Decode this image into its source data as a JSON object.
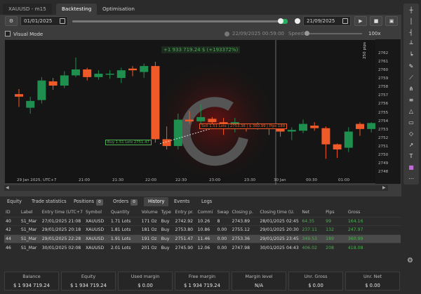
{
  "header": {
    "symbol_tab": "XAUUSD - m15",
    "tabs": [
      "Backtesting",
      "Optimisation"
    ]
  },
  "toolbar": {
    "start_date": "01/01/2025",
    "end_date": "21/09/2025",
    "play": "▶",
    "stop": "■",
    "save": "▣"
  },
  "chart_header": {
    "visual_mode": "Visual Mode",
    "datetime": "22/09/2025 00:59:00",
    "speed_label": "Speed:",
    "zoom": "100x"
  },
  "colors": {
    "bull": "#1e8f4e",
    "bear": "#f05a28",
    "positive": "#4caf50"
  },
  "chart_data": {
    "type": "candlestick",
    "x_labels": [
      "29 Jan 2025, UTC+7",
      "21:00",
      "21:30",
      "22:00",
      "22:30",
      "23:00",
      "23:30",
      "30 Jan",
      "00:30",
      "01:00"
    ],
    "y_ticks": [
      2762,
      2761,
      2760,
      2759,
      2758,
      2757,
      2756,
      2755,
      2754,
      2753,
      2752,
      2751,
      2750,
      2749,
      2748
    ],
    "ylim": [
      2747.5,
      2763
    ],
    "candles": [
      [
        2757.3,
        2757.0,
        2755.8,
        2757.9
      ],
      [
        2755.7,
        2756.5,
        2755.0,
        2757.0
      ],
      [
        2756.6,
        2758.9,
        2756.2,
        2759.3
      ],
      [
        2758.8,
        2758.3,
        2757.8,
        2759.2
      ],
      [
        2758.3,
        2759.5,
        2758.0,
        2760.0
      ],
      [
        2759.5,
        2760.2,
        2759.3,
        2761.6
      ],
      [
        2760.2,
        2759.3,
        2758.9,
        2760.4
      ],
      [
        2759.3,
        2759.7,
        2759.0,
        2760.1
      ],
      [
        2759.7,
        2759.7,
        2759.1,
        2760.1
      ],
      [
        2759.2,
        2760.1,
        2758.6,
        2760.4
      ],
      [
        2760.3,
        2760.1,
        2759.4,
        2760.6
      ],
      [
        2759.9,
        2760.6,
        2759.2,
        2760.9
      ],
      [
        2760.6,
        2752.0,
        2751.6,
        2761.1
      ],
      [
        2752.0,
        2751.2,
        2750.8,
        2753.5
      ],
      [
        2751.2,
        2754.3,
        2750.8,
        2755.0
      ],
      [
        2754.3,
        2754.1,
        2753.8,
        2755.3
      ],
      [
        2754.1,
        2754.6,
        2753.6,
        2756.1
      ],
      [
        2754.4,
        2754.0,
        2753.8,
        2754.6
      ],
      [
        2754.0,
        2753.2,
        2752.5,
        2754.5
      ],
      [
        2753.5,
        2754.0,
        2752.8,
        2754.5
      ],
      [
        2753.8,
        2753.4,
        2752.9,
        2753.8
      ],
      [
        2753.4,
        2753.6,
        2753.1,
        2754.0
      ],
      [
        2753.5,
        2753.2,
        2752.5,
        2753.7
      ],
      [
        2753.2,
        2752.9,
        2752.3,
        2753.7
      ],
      [
        2752.9,
        2753.1,
        2751.9,
        2753.4
      ],
      [
        2753.0,
        2753.8,
        2752.7,
        2754.3
      ],
      [
        2753.6,
        2753.3,
        2753.0,
        2754.0
      ],
      [
        2753.3,
        2751.4,
        2749.7,
        2753.5
      ],
      [
        2751.4,
        2750.8,
        2749.8,
        2751.5
      ],
      [
        2751.0,
        2752.9,
        2750.5,
        2753.4
      ],
      [
        2753.8,
        2753.2,
        2752.4,
        2754.0
      ],
      [
        2753.2,
        2753.9,
        2752.8,
        2754.0
      ]
    ]
  },
  "annotations": {
    "pnl": "+1 933 719.24 $ (+193372%)",
    "pips_label": "250 pips",
    "buy": "Buy 1.51 Lots 2751.47",
    "sell": "Sell 1.51 Lots",
    "sell_price": "2753.36",
    "sell_pnl": "$ 360.99",
    "sell_pips": "Pips 189"
  },
  "bottom_tabs": [
    {
      "label": "Equity"
    },
    {
      "label": "Trade statistics"
    },
    {
      "label": "Positions",
      "badge": "0"
    },
    {
      "label": "Orders",
      "badge": "0"
    },
    {
      "label": "History"
    },
    {
      "label": "Events"
    },
    {
      "label": "Logs"
    }
  ],
  "table": {
    "headers": [
      "ID",
      "Label",
      "Entry time (UTC+7",
      "Symbol",
      "Quantity",
      "Volume",
      "Type",
      "Entry pr.",
      "Commi",
      "Swap",
      "Closing p.",
      "Closing time (U.",
      "Net",
      "Pips",
      "Gross"
    ],
    "rows": [
      [
        "40",
        "S1_Mar",
        "27/01/2025 21:08",
        "XAUUSD",
        "1.71 Lots",
        "171 Oz",
        "Buy",
        "2742.92",
        "10.26",
        "8",
        "2743.89",
        "28/01/2025 02:45",
        "64.35",
        "99",
        "164.16"
      ],
      [
        "42",
        "S1_Mar",
        "29/01/2025 20:18",
        "XAUUSD",
        "1.81 Lots",
        "181 Oz",
        "Buy",
        "2753.80",
        "10.86",
        "0.00",
        "2755.12",
        "29/01/2025 20:30",
        "237.11",
        "132",
        "247.97"
      ],
      [
        "44",
        "S1_Mar",
        "29/01/2025 22:28",
        "XAUUSD",
        "1.91 Lots",
        "191 Oz",
        "Buy",
        "2751.47",
        "11.46",
        "0.00",
        "2753.36",
        "29/01/2025 23:45",
        "349.53",
        "189",
        "360.99"
      ],
      [
        "46",
        "S1_Mar",
        "30/01/2025 02:08",
        "XAUUSD",
        "2.01 Lots",
        "201 Oz",
        "Buy",
        "2745.90",
        "12.06",
        "0.00",
        "2747.98",
        "30/01/2025 04:43",
        "406.02",
        "208",
        "418.08"
      ]
    ]
  },
  "summary": [
    {
      "label": "Balance",
      "value": "$ 1 934 719.24"
    },
    {
      "label": "Equity",
      "value": "$ 1 934 719.24"
    },
    {
      "label": "Used margin",
      "value": "$ 0.00"
    },
    {
      "label": "Free margin",
      "value": "$ 1 934 719.24"
    },
    {
      "label": "Margin level",
      "value": "N/A"
    },
    {
      "label": "Unr. Gross",
      "value": "$ 0.00"
    },
    {
      "label": "Unr. Net",
      "value": "$ 0.00"
    }
  ]
}
